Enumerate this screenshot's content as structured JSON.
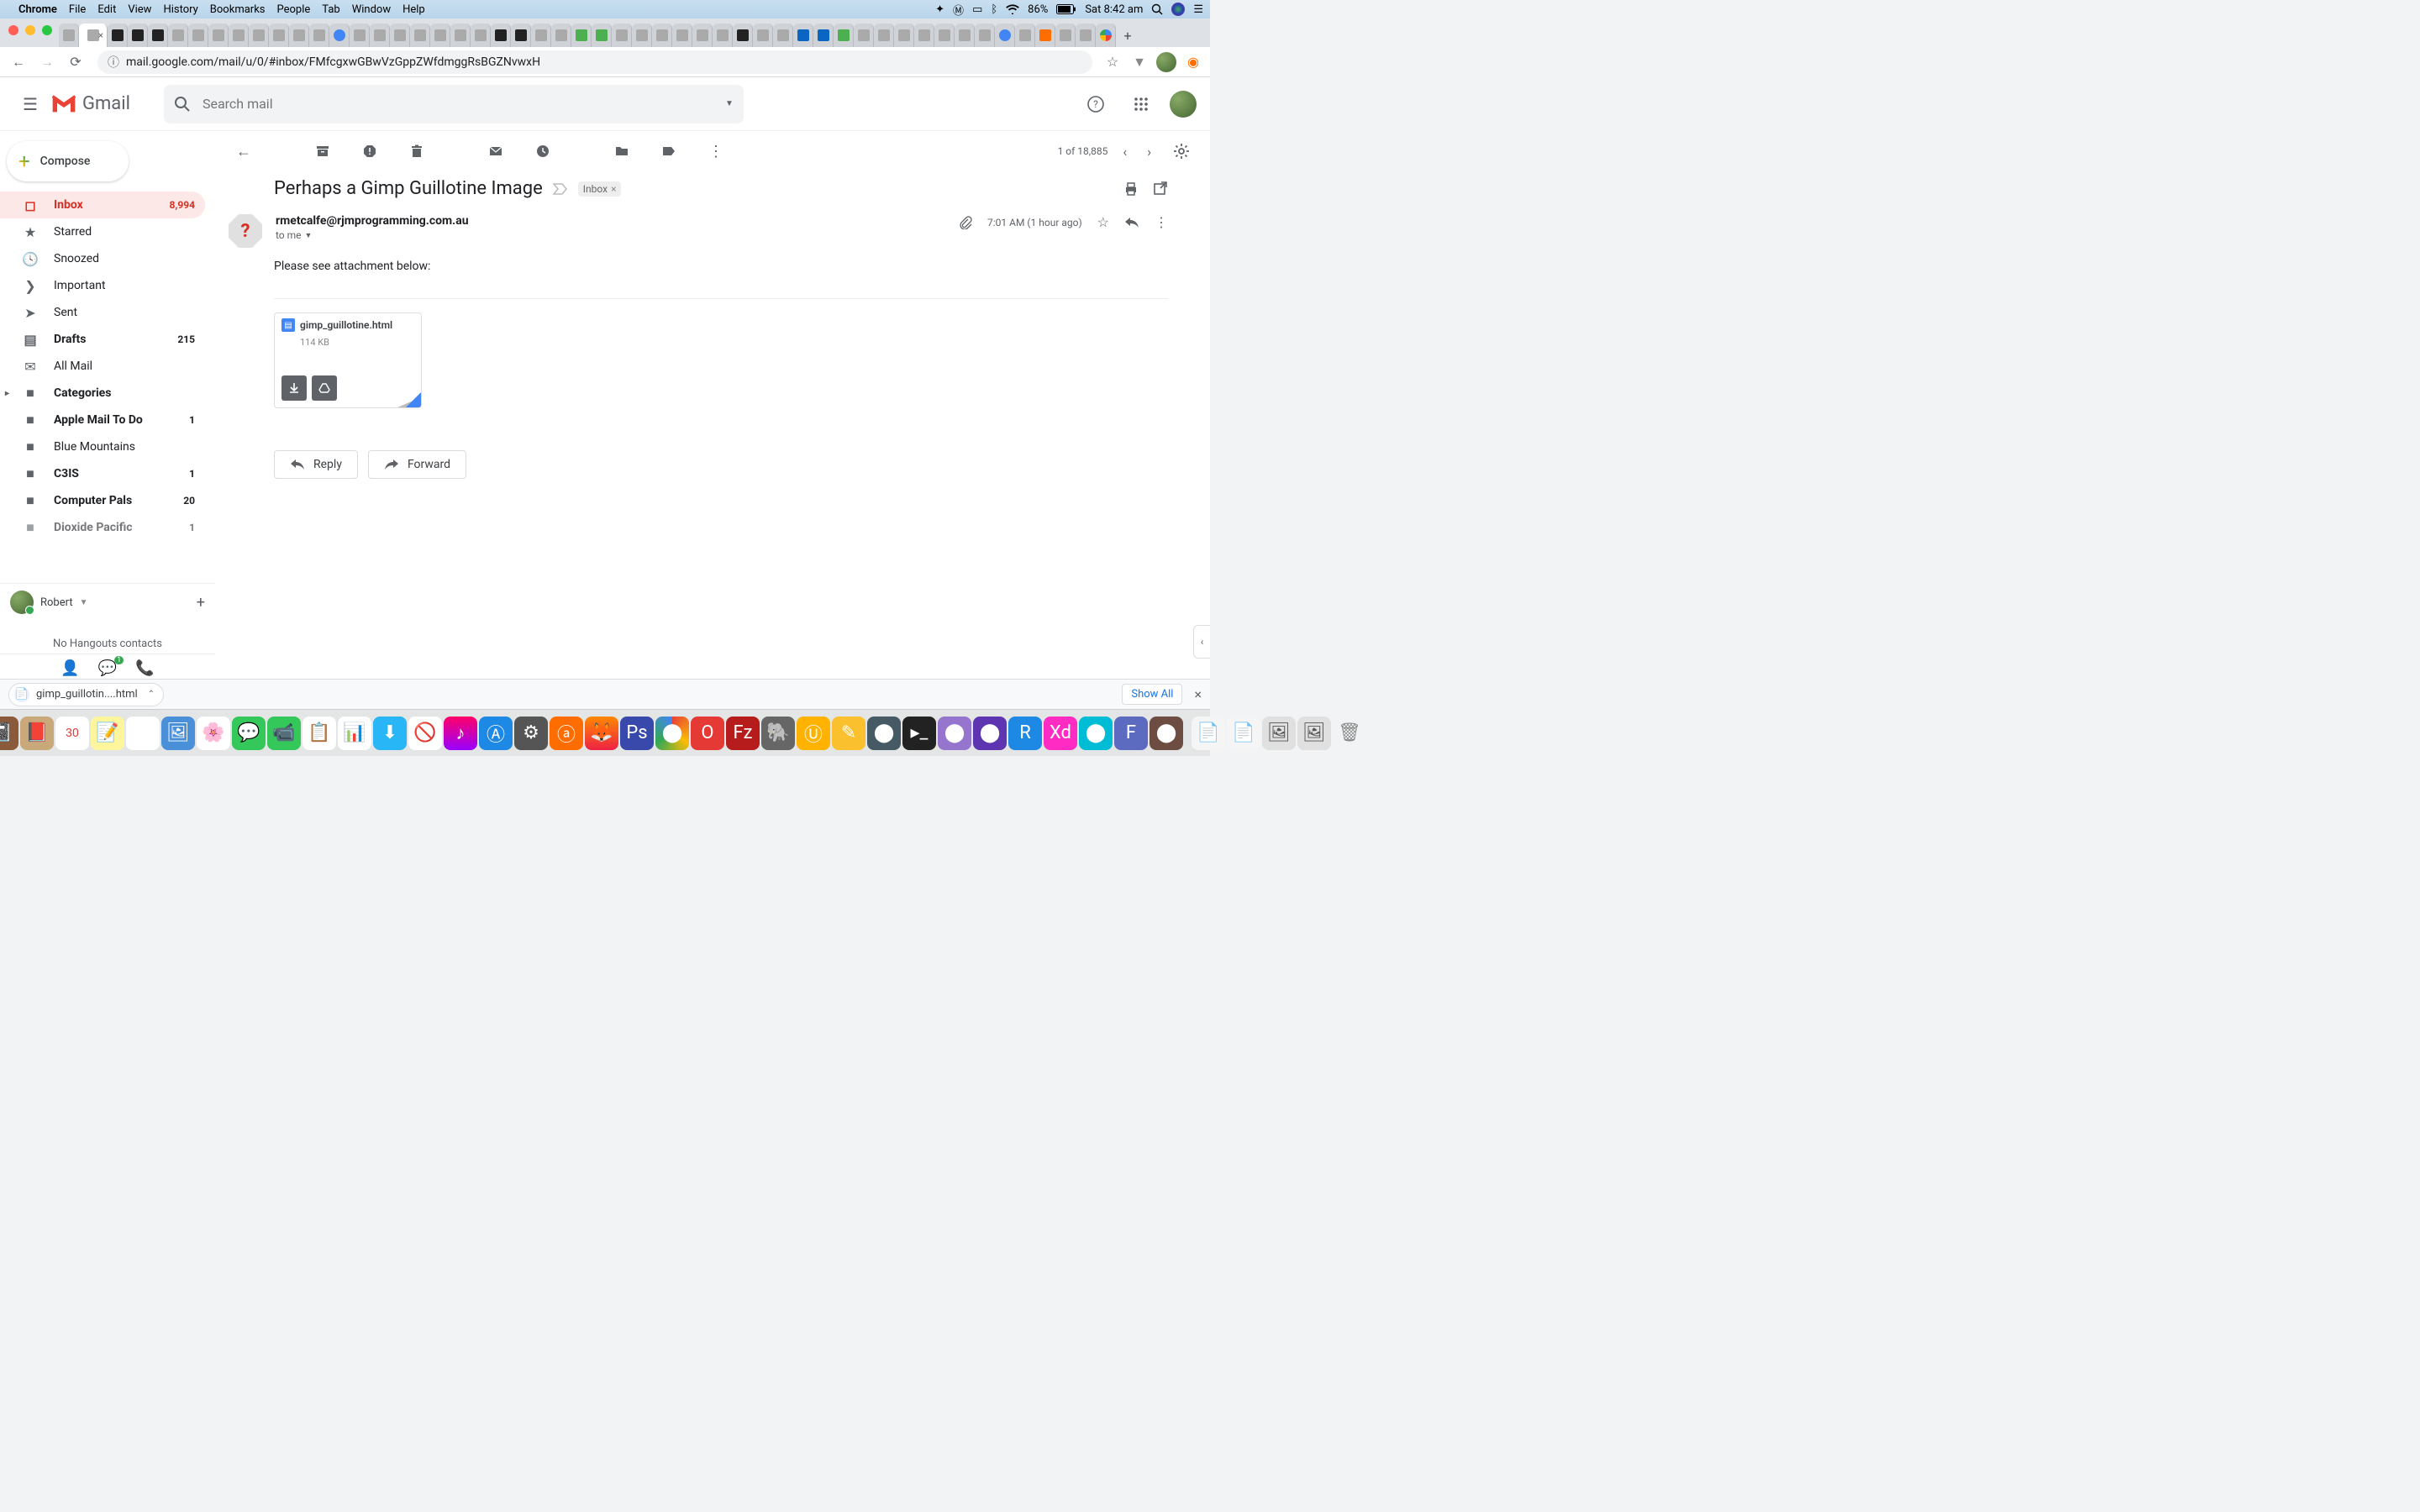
{
  "menubar": {
    "app": "Chrome",
    "items": [
      "File",
      "Edit",
      "View",
      "History",
      "Bookmarks",
      "People",
      "Tab",
      "Window",
      "Help"
    ],
    "battery": "86%",
    "clock": "Sat 8:42 am"
  },
  "browser": {
    "url": "mail.google.com/mail/u/0/#inbox/FMfcgxwGBwVzGppZWfdmggRsBGZNvwxH"
  },
  "gmail": {
    "logo_text": "Gmail",
    "search_placeholder": "Search mail"
  },
  "compose_label": "Compose",
  "sidebar": {
    "items": [
      {
        "icon": "inbox",
        "label": "Inbox",
        "count": "8,994",
        "active": true,
        "bold": true
      },
      {
        "icon": "star",
        "label": "Starred"
      },
      {
        "icon": "clock",
        "label": "Snoozed"
      },
      {
        "icon": "important",
        "label": "Important"
      },
      {
        "icon": "send",
        "label": "Sent"
      },
      {
        "icon": "draft",
        "label": "Drafts",
        "count": "215",
        "bold": true
      },
      {
        "icon": "mail",
        "label": "All Mail"
      },
      {
        "icon": "label",
        "label": "Categories",
        "bold": true,
        "expand": true
      },
      {
        "icon": "label",
        "label": "Apple Mail To Do",
        "count": "1",
        "bold": true
      },
      {
        "icon": "label",
        "label": "Blue Mountains"
      },
      {
        "icon": "label",
        "label": "C3IS",
        "count": "1",
        "bold": true
      },
      {
        "icon": "label",
        "label": "Computer Pals",
        "count": "20",
        "bold": true
      },
      {
        "icon": "label",
        "label": "Dioxide Pacific",
        "count": "1",
        "bold": true
      }
    ],
    "user": "Robert",
    "hangouts_empty": "No Hangouts contacts"
  },
  "toolbar": {
    "counter": "1 of 18,885"
  },
  "email": {
    "subject": "Perhaps a Gimp Guillotine Image",
    "label": "Inbox",
    "from": "rmetcalfe@rjmprogramming.com.au",
    "to": "to me",
    "time": "7:01 AM (1 hour ago)",
    "body": "Please see attachment below:",
    "attachment": {
      "name": "gimp_guillotine.html",
      "size": "114 KB"
    },
    "reply": "Reply",
    "forward": "Forward"
  },
  "downloads": {
    "item": "gimp_guillotin....html",
    "show_all": "Show All"
  },
  "hangouts_badge": "1"
}
